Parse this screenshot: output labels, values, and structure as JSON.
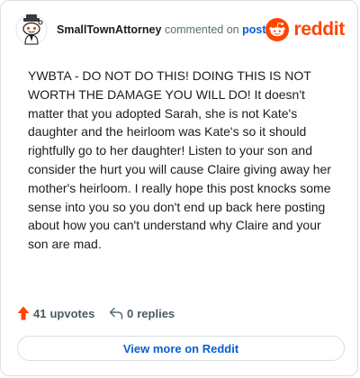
{
  "comment": {
    "author": "SmallTownAttorney",
    "action_text": "commented on",
    "post_link_text": "post",
    "body": "YWBTA - DO NOT DO THIS! DOING THIS IS NOT WORTH THE DAMAGE YOU WILL DO! It doesn't matter that you adopted Sarah, she is not Kate's daughter and the heirloom was Kate's so it should rightfully go to her daughter! Listen to your son and consider the hurt you will cause Claire giving away her mother's heirloom. I really hope this post knocks some sense into you so you don't end up back here posting about how you can't understand why Claire and your son are mad."
  },
  "brand": {
    "wordmark": "reddit",
    "logo_icon": "reddit-snoo-icon",
    "color": "#ff4500"
  },
  "stats": {
    "upvotes_count": "41",
    "upvotes_label": "upvotes",
    "upvote_icon": "upvote-arrow-icon",
    "upvote_color": "#ff4500",
    "replies_count": "0",
    "replies_label": "replies",
    "reply_icon": "reply-arrow-icon"
  },
  "footer": {
    "view_more_label": "View more on Reddit",
    "link_color": "#0a5ed6"
  }
}
